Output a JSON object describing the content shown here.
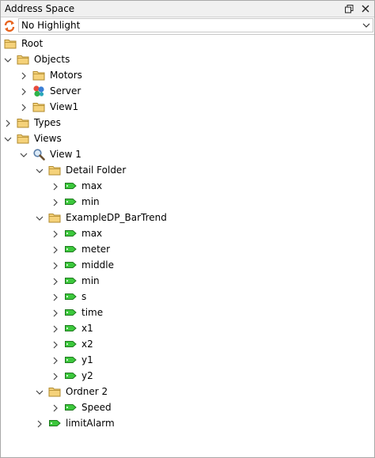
{
  "panel": {
    "title": "Address Space",
    "highlight_value": "No Highlight",
    "icons": {
      "restore": "restore-window-icon",
      "close": "close-icon",
      "refresh": "refresh-icon",
      "dropdown": "chevron-down-icon"
    }
  },
  "tree": [
    {
      "label": "Root",
      "depth": 0,
      "icon": "folder",
      "expander": "none"
    },
    {
      "label": "Objects",
      "depth": 0,
      "icon": "folder",
      "expander": "expanded"
    },
    {
      "label": "Motors",
      "depth": 1,
      "icon": "folder",
      "expander": "collapsed"
    },
    {
      "label": "Server",
      "depth": 1,
      "icon": "server",
      "expander": "collapsed"
    },
    {
      "label": "View1",
      "depth": 1,
      "icon": "folder",
      "expander": "collapsed"
    },
    {
      "label": "Types",
      "depth": 0,
      "icon": "folder",
      "expander": "collapsed"
    },
    {
      "label": "Views",
      "depth": 0,
      "icon": "folder",
      "expander": "expanded"
    },
    {
      "label": "View 1",
      "depth": 1,
      "icon": "view",
      "expander": "expanded"
    },
    {
      "label": "Detail Folder",
      "depth": 2,
      "icon": "folder",
      "expander": "expanded"
    },
    {
      "label": "max",
      "depth": 3,
      "icon": "tag",
      "expander": "collapsed"
    },
    {
      "label": "min",
      "depth": 3,
      "icon": "tag",
      "expander": "collapsed"
    },
    {
      "label": "ExampleDP_BarTrend",
      "depth": 2,
      "icon": "folder",
      "expander": "expanded"
    },
    {
      "label": "max",
      "depth": 3,
      "icon": "tag",
      "expander": "collapsed"
    },
    {
      "label": "meter",
      "depth": 3,
      "icon": "tag",
      "expander": "collapsed"
    },
    {
      "label": "middle",
      "depth": 3,
      "icon": "tag",
      "expander": "collapsed"
    },
    {
      "label": "min",
      "depth": 3,
      "icon": "tag",
      "expander": "collapsed"
    },
    {
      "label": "s",
      "depth": 3,
      "icon": "tag",
      "expander": "collapsed"
    },
    {
      "label": "time",
      "depth": 3,
      "icon": "tag",
      "expander": "collapsed"
    },
    {
      "label": "x1",
      "depth": 3,
      "icon": "tag",
      "expander": "collapsed"
    },
    {
      "label": "x2",
      "depth": 3,
      "icon": "tag",
      "expander": "collapsed"
    },
    {
      "label": "y1",
      "depth": 3,
      "icon": "tag",
      "expander": "collapsed"
    },
    {
      "label": "y2",
      "depth": 3,
      "icon": "tag",
      "expander": "collapsed"
    },
    {
      "label": "Ordner 2",
      "depth": 2,
      "icon": "folder",
      "expander": "expanded"
    },
    {
      "label": "Speed",
      "depth": 3,
      "icon": "tag",
      "expander": "collapsed"
    },
    {
      "label": "limitAlarm",
      "depth": 2,
      "icon": "tag",
      "expander": "collapsed"
    }
  ],
  "colors": {
    "folder_fill": "#f5d27a",
    "folder_stroke": "#b08a2e",
    "tag_fill": "#3cc83c",
    "tag_stroke": "#1f7a1f",
    "refresh_orange": "#e8641e",
    "expander": "#444444"
  }
}
